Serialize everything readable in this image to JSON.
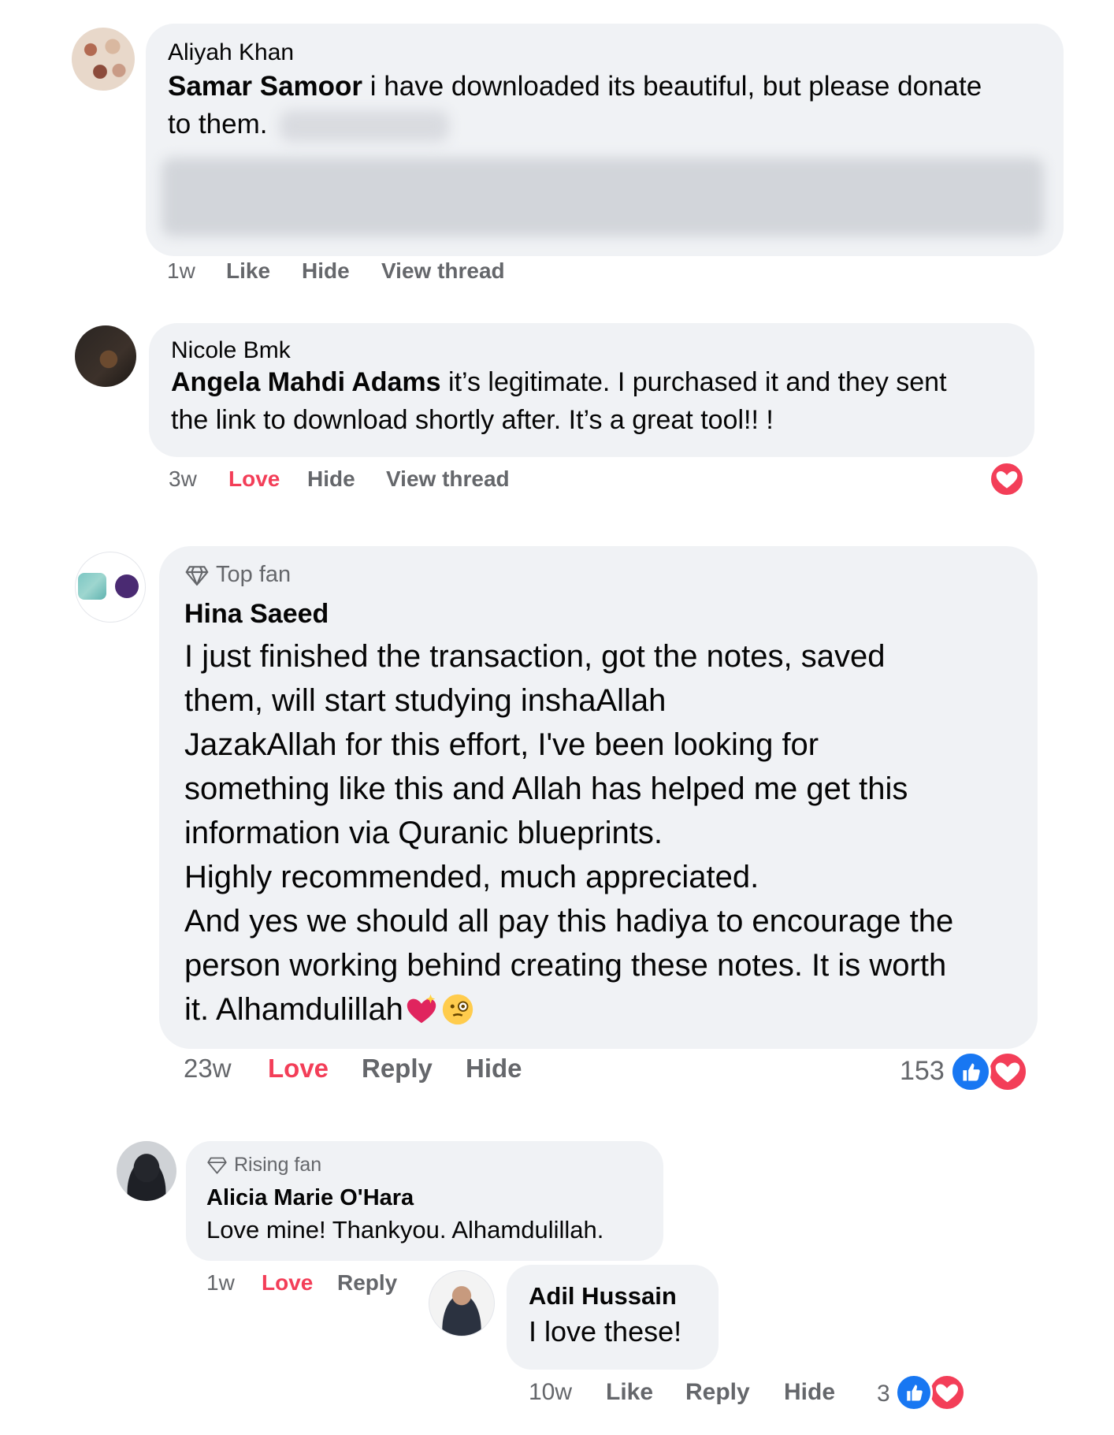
{
  "comments": [
    {
      "author": "Aliyah Khan",
      "mention": "Samar Samoor",
      "text_line1": " i have downloaded its beautiful, but please donate",
      "text_line2": "to them.",
      "time": "1w",
      "actions": [
        "Like",
        "Hide",
        "View thread"
      ]
    },
    {
      "author": "Nicole Bmk",
      "mention": "Angela Mahdi Adams",
      "text_line1": " it’s legitimate. I purchased it and they sent",
      "text_line2": "the link to download shortly after. It’s a great tool!! !",
      "time": "3w",
      "actions": [
        "Love",
        "Hide",
        "View thread"
      ],
      "reaction": "love-icon"
    },
    {
      "badge": "Top fan",
      "author": "Hina Saeed",
      "lines": [
        "I just finished the transaction, got the notes, saved",
        "them, will start studying inshaAllah",
        "JazakAllah for this effort, I've been looking for",
        "something like this and Allah has helped me get this",
        "information via Quranic blueprints.",
        "Highly recommended, much appreciated.",
        "And yes we should all pay this hadiya to encourage the",
        "person working behind creating these notes. It is worth",
        "it. Alhamdulillah"
      ],
      "time": "23w",
      "actions": [
        "Love",
        "Reply",
        "Hide"
      ],
      "reaction_count": "153"
    }
  ],
  "replies": [
    {
      "badge": "Rising fan",
      "author": "Alicia Marie O'Hara",
      "text": "Love mine! Thankyou. Alhamdulillah.",
      "time": "1w",
      "actions": [
        "Love",
        "Reply"
      ]
    },
    {
      "author": "Adil Hussain",
      "text": "I love these!",
      "time": "10w",
      "actions": [
        "Like",
        "Reply",
        "Hide"
      ],
      "reaction_count": "3"
    }
  ],
  "colors": {
    "bubble": "#f0f2f5",
    "meta": "#65676b",
    "love": "#f33e58",
    "like": "#1877f2"
  }
}
